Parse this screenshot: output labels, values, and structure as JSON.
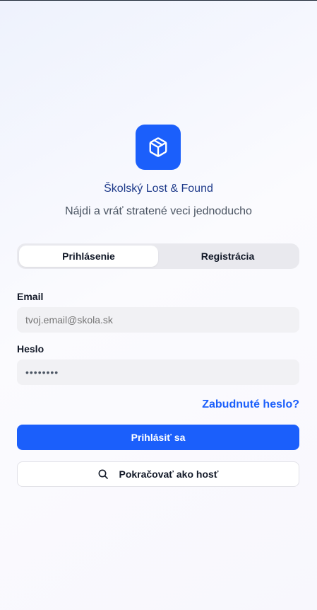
{
  "app": {
    "title": "Školský Lost & Found",
    "subtitle": "Nájdi a vráť stratené veci jednoducho",
    "logo_icon": "package-icon",
    "accent_color": "#1b5ffb"
  },
  "tabs": [
    {
      "label": "Prihlásenie",
      "active": true
    },
    {
      "label": "Registrácia",
      "active": false
    }
  ],
  "form": {
    "email_label": "Email",
    "email_placeholder": "tvoj.email@skola.sk",
    "password_label": "Heslo",
    "password_value": "••••••••",
    "forgot_label": "Zabudnuté heslo?"
  },
  "buttons": {
    "login_label": "Prihlásiť sa",
    "guest_label": "Pokračovať ako hosť",
    "guest_icon": "search-icon"
  }
}
